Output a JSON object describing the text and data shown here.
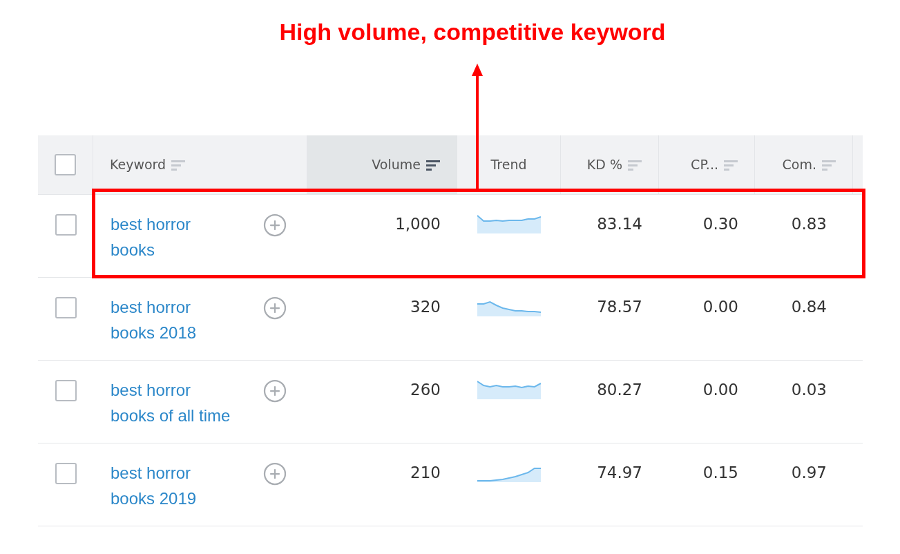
{
  "annotation": {
    "text": "High volume, competitive keyword"
  },
  "table": {
    "header_checkbox": {
      "checked": false
    },
    "columns": [
      {
        "label": "Keyword",
        "sorted": false
      },
      {
        "label": "Volume",
        "sorted": true
      },
      {
        "label": "Trend"
      },
      {
        "label": "KD %",
        "sorted": false
      },
      {
        "label": "CP...",
        "sorted": false
      },
      {
        "label": "Com.",
        "sorted": false
      }
    ],
    "rows": [
      {
        "checked": false,
        "highlighted": true,
        "keyword": "best horror books",
        "volume": "1,000",
        "kd": "83.14",
        "cpc": "0.30",
        "com": "0.83"
      },
      {
        "checked": false,
        "highlighted": false,
        "keyword": "best horror books 2018",
        "volume": "320",
        "kd": "78.57",
        "cpc": "0.00",
        "com": "0.84"
      },
      {
        "checked": false,
        "highlighted": false,
        "keyword": "best horror books of all time",
        "volume": "260",
        "kd": "80.27",
        "cpc": "0.00",
        "com": "0.03"
      },
      {
        "checked": false,
        "highlighted": false,
        "keyword": "best horror books 2019",
        "volume": "210",
        "kd": "74.97",
        "cpc": "0.15",
        "com": "0.97"
      }
    ]
  }
}
